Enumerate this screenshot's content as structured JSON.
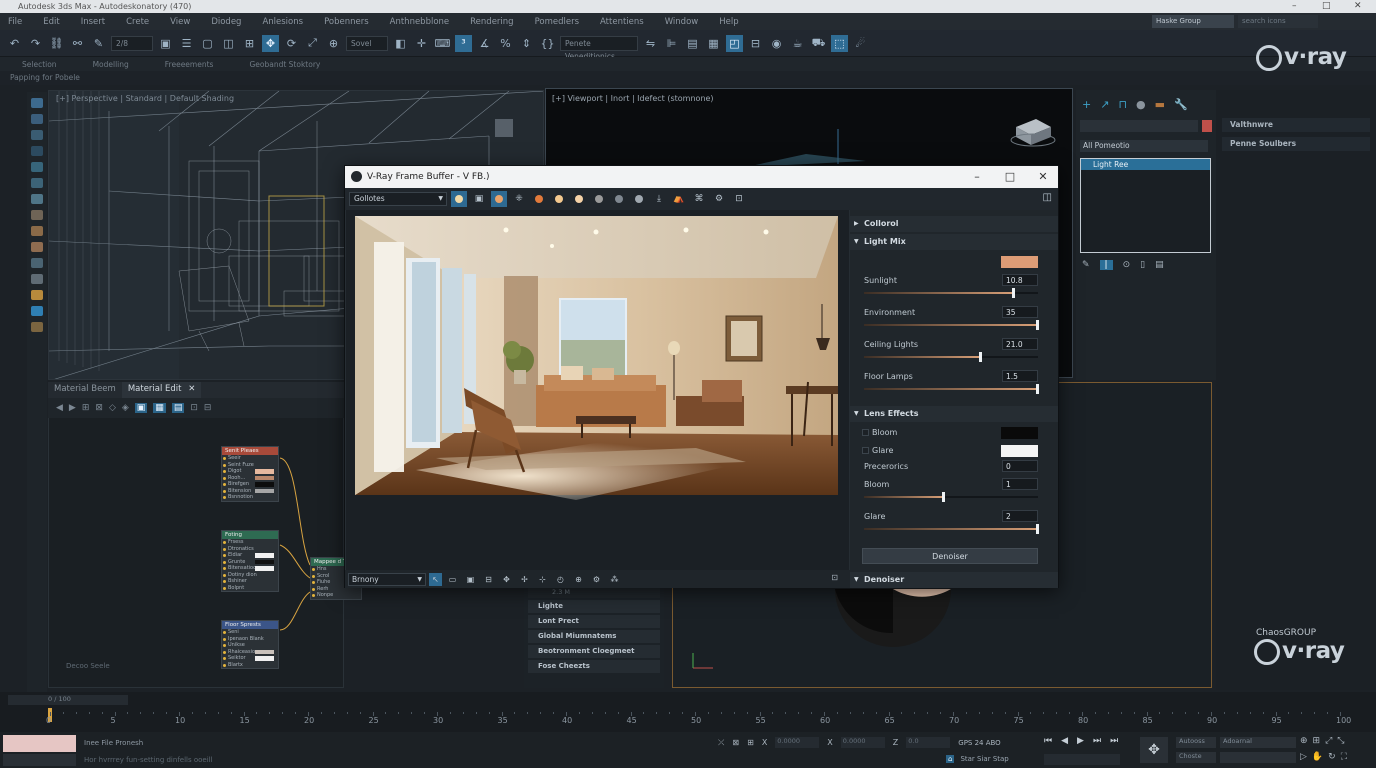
{
  "window": {
    "title": "Autodesk 3ds Max - Autodeskonatory (470)",
    "controls": [
      "–",
      "□",
      "✕"
    ]
  },
  "menu": [
    "File",
    "Edit",
    "Insert",
    "Crete",
    "View",
    "Diodeg",
    "Anlesions",
    "Pobenners",
    "Anthnebblone",
    "Rendering",
    "Pomedlers",
    "Attentiens",
    "Window",
    "Help"
  ],
  "toolbar": {
    "selection_drop": "Sovel",
    "named_sets_drop": "Penete Veneditionics",
    "zoom_value": "2/8"
  },
  "topright": {
    "workspace": "Haske Group",
    "search": "search icons"
  },
  "ribbon": {
    "tabs": [
      "Selection",
      "Modelling",
      "Freeeements",
      "Geobandt Stoktory"
    ],
    "subtitle": "Papping for Pobele"
  },
  "viewports": {
    "top_left_label": "[+] Perspective | Standard | Default Shading",
    "top_right_label": "[+] Viewport | Inort | Idefect (stomnone)"
  },
  "material_editor": {
    "tabs": [
      "Material Beem",
      "Material Edit"
    ],
    "close": "✕",
    "nodes": [
      {
        "title": "Senit Pleaes",
        "sub": "Seeir",
        "rows": [
          "Seint Fuze",
          "Digot",
          "Rooh...",
          "Birefgen",
          "Bitension",
          "Bsnnotion"
        ],
        "header_color": "#a84a3a"
      },
      {
        "title": "Foting",
        "sub": "Frsess",
        "rows": [
          "Dtronatics",
          "Eldiar",
          "Grunte",
          "Bitensatioon",
          "Dotiny dion",
          "Bshiner",
          "Bolpnt"
        ],
        "header_color": "#2e6b52"
      },
      {
        "title": "Floor Sprests",
        "sub": "Seni",
        "rows": [
          "Ipenaon Blank",
          "Unikse",
          "Rhaiceasion",
          "Seiktor",
          "Blartx"
        ],
        "header_color": "#3b5588"
      },
      {
        "title": "Mappee d Teon",
        "sub": "",
        "rows": [
          "Hns",
          "Scrol",
          "Fiuhe",
          "Rerh",
          "Nonpe"
        ],
        "header_color": "#2e6b52"
      }
    ],
    "footer": "Decoo Seele"
  },
  "vfb": {
    "title": "V-Ray Frame Buffer - V FB.)",
    "channel": "Gollotes",
    "bottom_drop": "Brnony",
    "sections": {
      "collapsed_top": "Collorol",
      "light_mix": "Light Mix",
      "lens_effects": "Lens Effects",
      "denoiser_section": "Denoiser"
    },
    "light_mix_color": "#dd9c76",
    "light_mix": [
      {
        "label": "Sunlight",
        "value": "10.8",
        "level": 0.86
      },
      {
        "label": "Environment",
        "value": "35",
        "level": 1.0
      },
      {
        "label": "Ceiling Lights",
        "value": "21.0",
        "level": 0.67
      },
      {
        "label": "Floor Lamps",
        "value": "1.5",
        "level": 1.0
      }
    ],
    "lens": {
      "bloom_check": "Bloom",
      "glare_check": "Glare",
      "bloom_color": "#0a0a0a",
      "glare_color": "#f4f4f4",
      "precerorics_label": "Precerorics",
      "precerorics_value": "0",
      "bloom_label": "Bloom",
      "bloom_value": "1",
      "bloom_level": 0.46,
      "glare_label": "Glare",
      "glare_value": "2",
      "glare_level": 1.0
    },
    "denoiser_button": "Denoiser"
  },
  "command_panel": {
    "dropdown": "All Pomeotio",
    "list_selected": "Light Ree"
  },
  "right_column": {
    "items": [
      "Valthnwre",
      "Penne Soulbers"
    ],
    "brand_top": "v·ray",
    "brand_group": "ChaosGROUP",
    "brand_bottom": "v·ray"
  },
  "render_settings": {
    "value_field": "2.3 M",
    "rows": [
      "Lighte",
      "Lont Prect",
      "Global Miumnatems",
      "Beotronment Cloegmeet",
      "Fose Cheezts"
    ]
  },
  "timeline": {
    "frame_slider": "0 / 100",
    "ticks": [
      "0",
      "5",
      "10",
      "15",
      "20",
      "25",
      "30",
      "35",
      "40",
      "45",
      "50",
      "55",
      "60",
      "65",
      "70",
      "75",
      "80",
      "85",
      "90",
      "95",
      "100"
    ]
  },
  "status": {
    "line1": "Inee File Pronesh",
    "line2": "Hor hvrrrey fun-setting dinfells ooeill",
    "x_label": "X",
    "x_value": "0.0000",
    "y_label": "X",
    "y_value": "0.0000",
    "z_label": "Z",
    "z_value": "0.0",
    "grid": "GPS 24 ABO",
    "hint": "Star Siar Stap",
    "autokey": "Autooss",
    "setkey": "Adoarnal",
    "filters": "Choste"
  }
}
